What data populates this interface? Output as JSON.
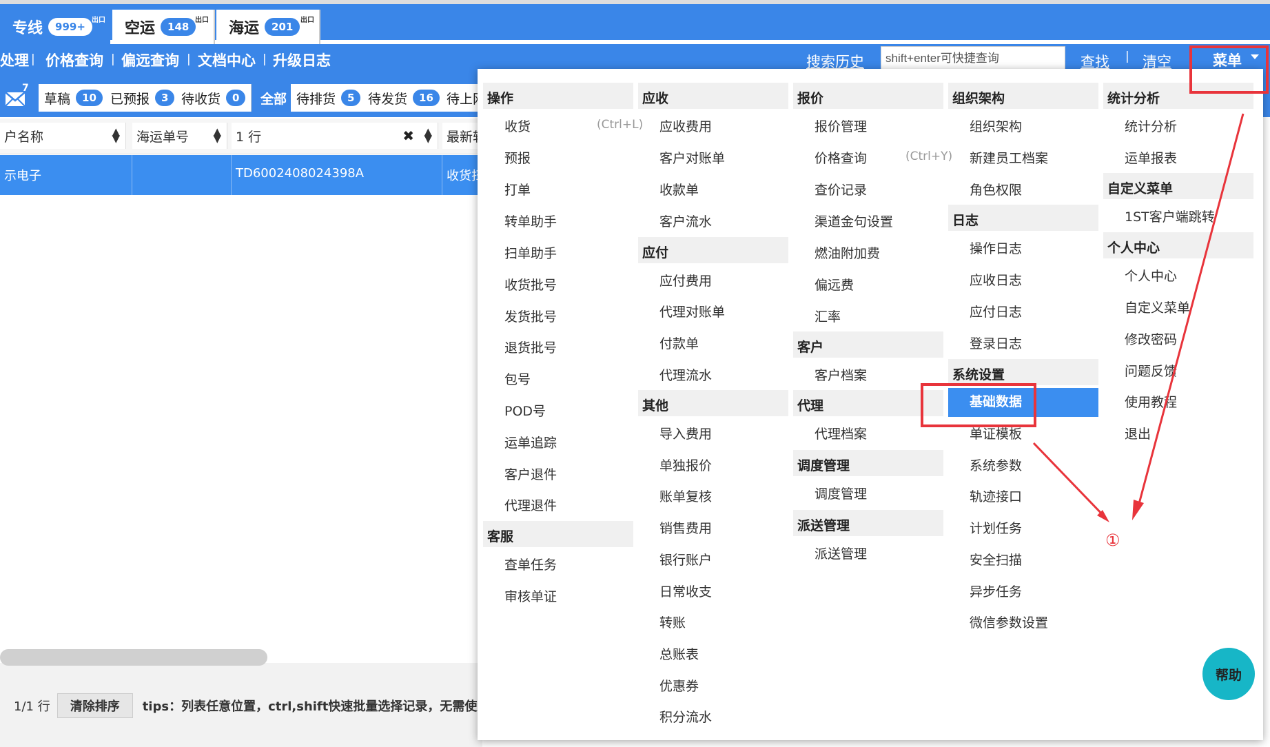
{
  "tabs": [
    {
      "label": "专线",
      "count": "999+",
      "tag": "出口"
    },
    {
      "label": "空运",
      "count": "148",
      "tag": "出口"
    },
    {
      "label": "海运",
      "count": "201",
      "tag": "出口"
    }
  ],
  "nav": {
    "links": [
      "处理",
      "价格查询",
      "偏远查询",
      "文档中心",
      "升级日志"
    ],
    "separator": "|",
    "search_history": "搜索历史",
    "search_placeholder": "shift+enter可快捷查询",
    "find": "查找",
    "clear": "清空",
    "menu": "菜单"
  },
  "status": {
    "mail_count": "7",
    "tabs": [
      {
        "label": "草稿",
        "count": "10"
      },
      {
        "label": "已预报",
        "count": "3"
      },
      {
        "label": "待收货",
        "count": "0"
      },
      {
        "label": "全部",
        "count": ""
      },
      {
        "label": "待排货",
        "count": "5"
      },
      {
        "label": "待发货",
        "count": "16"
      },
      {
        "label": "待上网",
        "count": ""
      }
    ]
  },
  "table": {
    "headers": [
      "户名称",
      "海运单号",
      "1 行",
      "最新轨"
    ],
    "row": [
      "示电子",
      "",
      "TD6002408024398A",
      "收货扫"
    ],
    "pager": "1/1 行",
    "clear_sort": "清除排序",
    "tips": "tips：列表任意位置，ctrl,shift快速批量选择记录，无需使用选"
  },
  "menu": {
    "col1": {
      "title": "操作",
      "items": [
        "收货",
        "预报",
        "打单",
        "转单助手",
        "扫单助手",
        "收货批号",
        "发货批号",
        "退货批号",
        "包号",
        "POD号",
        "运单追踪",
        "客户退件",
        "代理退件"
      ],
      "shortcut": "(Ctrl+L)",
      "sec2": "客服",
      "items2": [
        "查单任务",
        "审核单证"
      ]
    },
    "col2": {
      "title": "应收",
      "items": [
        "应收费用",
        "客户对账单",
        "收款单",
        "客户流水"
      ],
      "sec2": "应付",
      "items2": [
        "应付费用",
        "代理对账单",
        "付款单",
        "代理流水"
      ],
      "sec3": "其他",
      "items3": [
        "导入费用",
        "单独报价",
        "账单复核",
        "销售费用",
        "银行账户",
        "日常收支",
        "转账",
        "总账表",
        "优惠券",
        "积分流水"
      ]
    },
    "col3": {
      "title": "报价",
      "items": [
        "报价管理",
        "价格查询",
        "查价记录",
        "渠道金句设置",
        "燃油附加费",
        "偏远费",
        "汇率"
      ],
      "shortcut": "(Ctrl+Y)",
      "sec2": "客户",
      "items2": [
        "客户档案"
      ],
      "sec3": "代理",
      "items3": [
        "代理档案"
      ],
      "sec4": "调度管理",
      "items4": [
        "调度管理"
      ],
      "sec5": "派送管理",
      "items5": [
        "派送管理"
      ]
    },
    "col4": {
      "title": "组织架构",
      "items": [
        "组织架构",
        "新建员工档案",
        "角色权限"
      ],
      "sec2": "日志",
      "items2": [
        "操作日志",
        "应收日志",
        "应付日志",
        "登录日志"
      ],
      "sec3": "系统设置",
      "items3": [
        "基础数据",
        "单证模板",
        "系统参数",
        "轨迹接口",
        "计划任务",
        "安全扫描",
        "异步任务",
        "微信参数设置"
      ]
    },
    "col5": {
      "title": "统计分析",
      "items": [
        "统计分析",
        "运单报表"
      ],
      "sec2": "自定义菜单",
      "items2": [
        "1ST客户端跳转"
      ],
      "sec3": "个人中心",
      "items3": [
        "个人中心",
        "自定义菜单",
        "修改密码",
        "问题反馈",
        "使用教程",
        "退出"
      ]
    }
  },
  "annotation": "①",
  "help": "帮助",
  "colors": {
    "primary": "#3a86e8",
    "highlight": "#3b8ef0",
    "annotation": "#e8343b",
    "help": "#17b6c7"
  }
}
